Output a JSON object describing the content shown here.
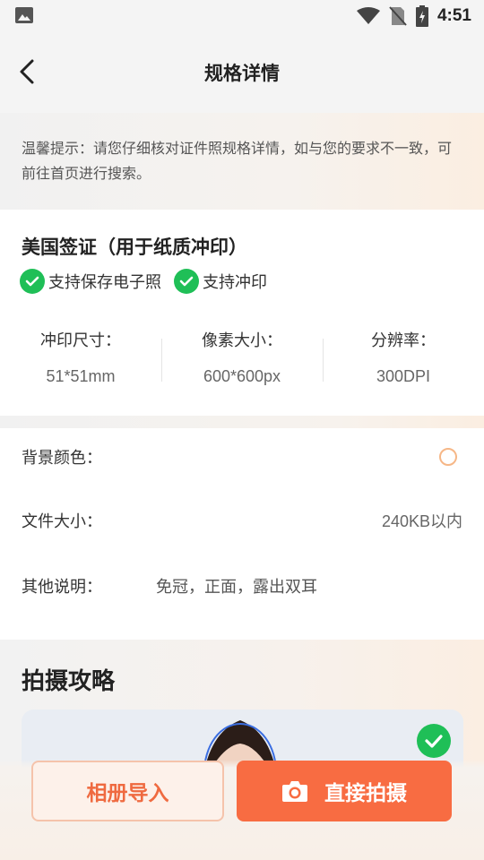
{
  "status_bar": {
    "time": "4:51",
    "icons": [
      "gallery-icon",
      "wifi-icon",
      "no-sim-icon",
      "battery-charging-icon"
    ]
  },
  "nav": {
    "back_icon": "chevron-left-icon",
    "title": "规格详情"
  },
  "tip": {
    "text": "温馨提示：请您仔细核对证件照规格详情，如与您的要求不一致，可前往首页进行搜索。"
  },
  "spec": {
    "name": "美国签证（用于纸质冲印）",
    "badges": [
      {
        "label": "支持保存电子照",
        "icon": "check-circle-icon"
      },
      {
        "label": "支持冲印",
        "icon": "check-circle-icon"
      }
    ],
    "metrics": [
      {
        "label": "冲印尺寸：",
        "value": "51*51mm"
      },
      {
        "label": "像素大小：",
        "value": "600*600px"
      },
      {
        "label": "分辨率：",
        "value": "300DPI"
      }
    ]
  },
  "info": {
    "background_label": "背景颜色：",
    "file_size_label": "文件大小：",
    "file_size_value": "240KB以内",
    "notes_label": "其他说明：",
    "notes_value": "免冠，正面，露出双耳"
  },
  "guide": {
    "title": "拍摄攻略",
    "status_icon": "check-circle-icon"
  },
  "actions": {
    "album_label": "相册导入",
    "shoot_label": "直接拍摄",
    "shoot_icon": "camera-icon"
  },
  "colors": {
    "accent": "#f86c42",
    "success": "#1fbf57"
  }
}
